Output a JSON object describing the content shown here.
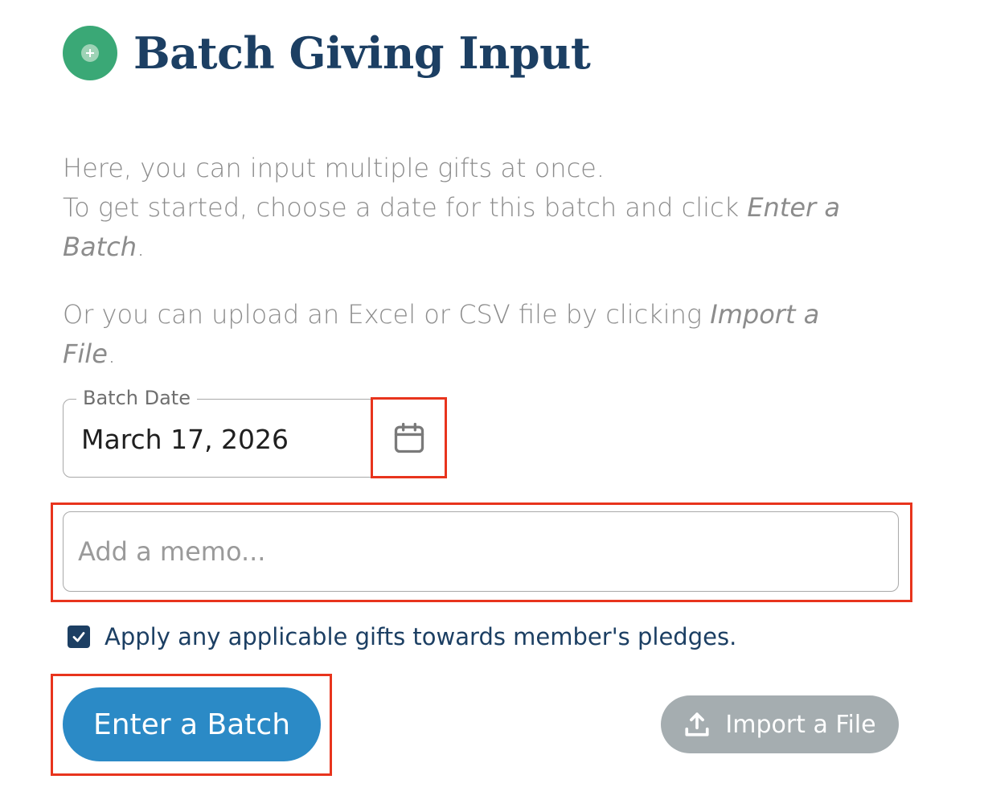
{
  "header": {
    "title": "Batch Giving Input",
    "icon": "plus-circle-icon",
    "icon_color": "#3aa876",
    "title_color": "#1c3f63"
  },
  "intro": {
    "line1": "Here, you can input multiple gifts at once.",
    "line2_prefix": "To get started, choose a date for this batch and click ",
    "line2_em": "Enter a Batch",
    "line2_suffix": ".",
    "line3_prefix": "Or you can upload an Excel or CSV file by clicking ",
    "line3_em": "Import a File",
    "line3_suffix": "."
  },
  "batch_date": {
    "label": "Batch Date",
    "value": "March 17, 2026",
    "icon": "calendar-icon"
  },
  "memo": {
    "placeholder": "Add a memo...",
    "value": ""
  },
  "pledge_option": {
    "label": "Apply any applicable gifts towards member's pledges.",
    "checked": true
  },
  "actions": {
    "enter_label": "Enter a Batch",
    "import_label": "Import a File",
    "import_icon": "upload-icon",
    "enter_color": "#2b8ac6",
    "import_color": "#a5adb0"
  },
  "highlight_color": "#e8341d"
}
